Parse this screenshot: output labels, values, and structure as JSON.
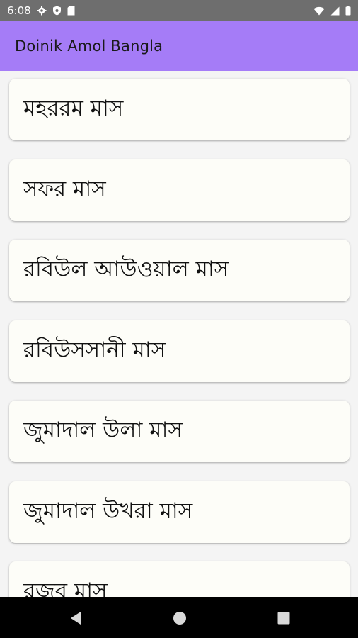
{
  "status_bar": {
    "time": "6:08",
    "left_icons": [
      "gear-icon",
      "shield-icon",
      "sd-card-icon"
    ],
    "right_icons": [
      "wifi-icon",
      "signal-icon",
      "battery-icon"
    ]
  },
  "app_bar": {
    "title": "Doinik Amol Bangla",
    "color": "#a57cf7"
  },
  "list": {
    "items": [
      {
        "label": "মহররম মাস"
      },
      {
        "label": "সফর মাস"
      },
      {
        "label": "রবিউল আউওয়াল মাস"
      },
      {
        "label": "রবিউসসানী মাস"
      },
      {
        "label": "জুমাদাল উলা মাস"
      },
      {
        "label": "জুমাদাল উখরা মাস"
      },
      {
        "label": "রজব মাস"
      }
    ]
  },
  "nav_bar": {
    "buttons": [
      "back-icon",
      "home-icon",
      "recents-icon"
    ]
  }
}
